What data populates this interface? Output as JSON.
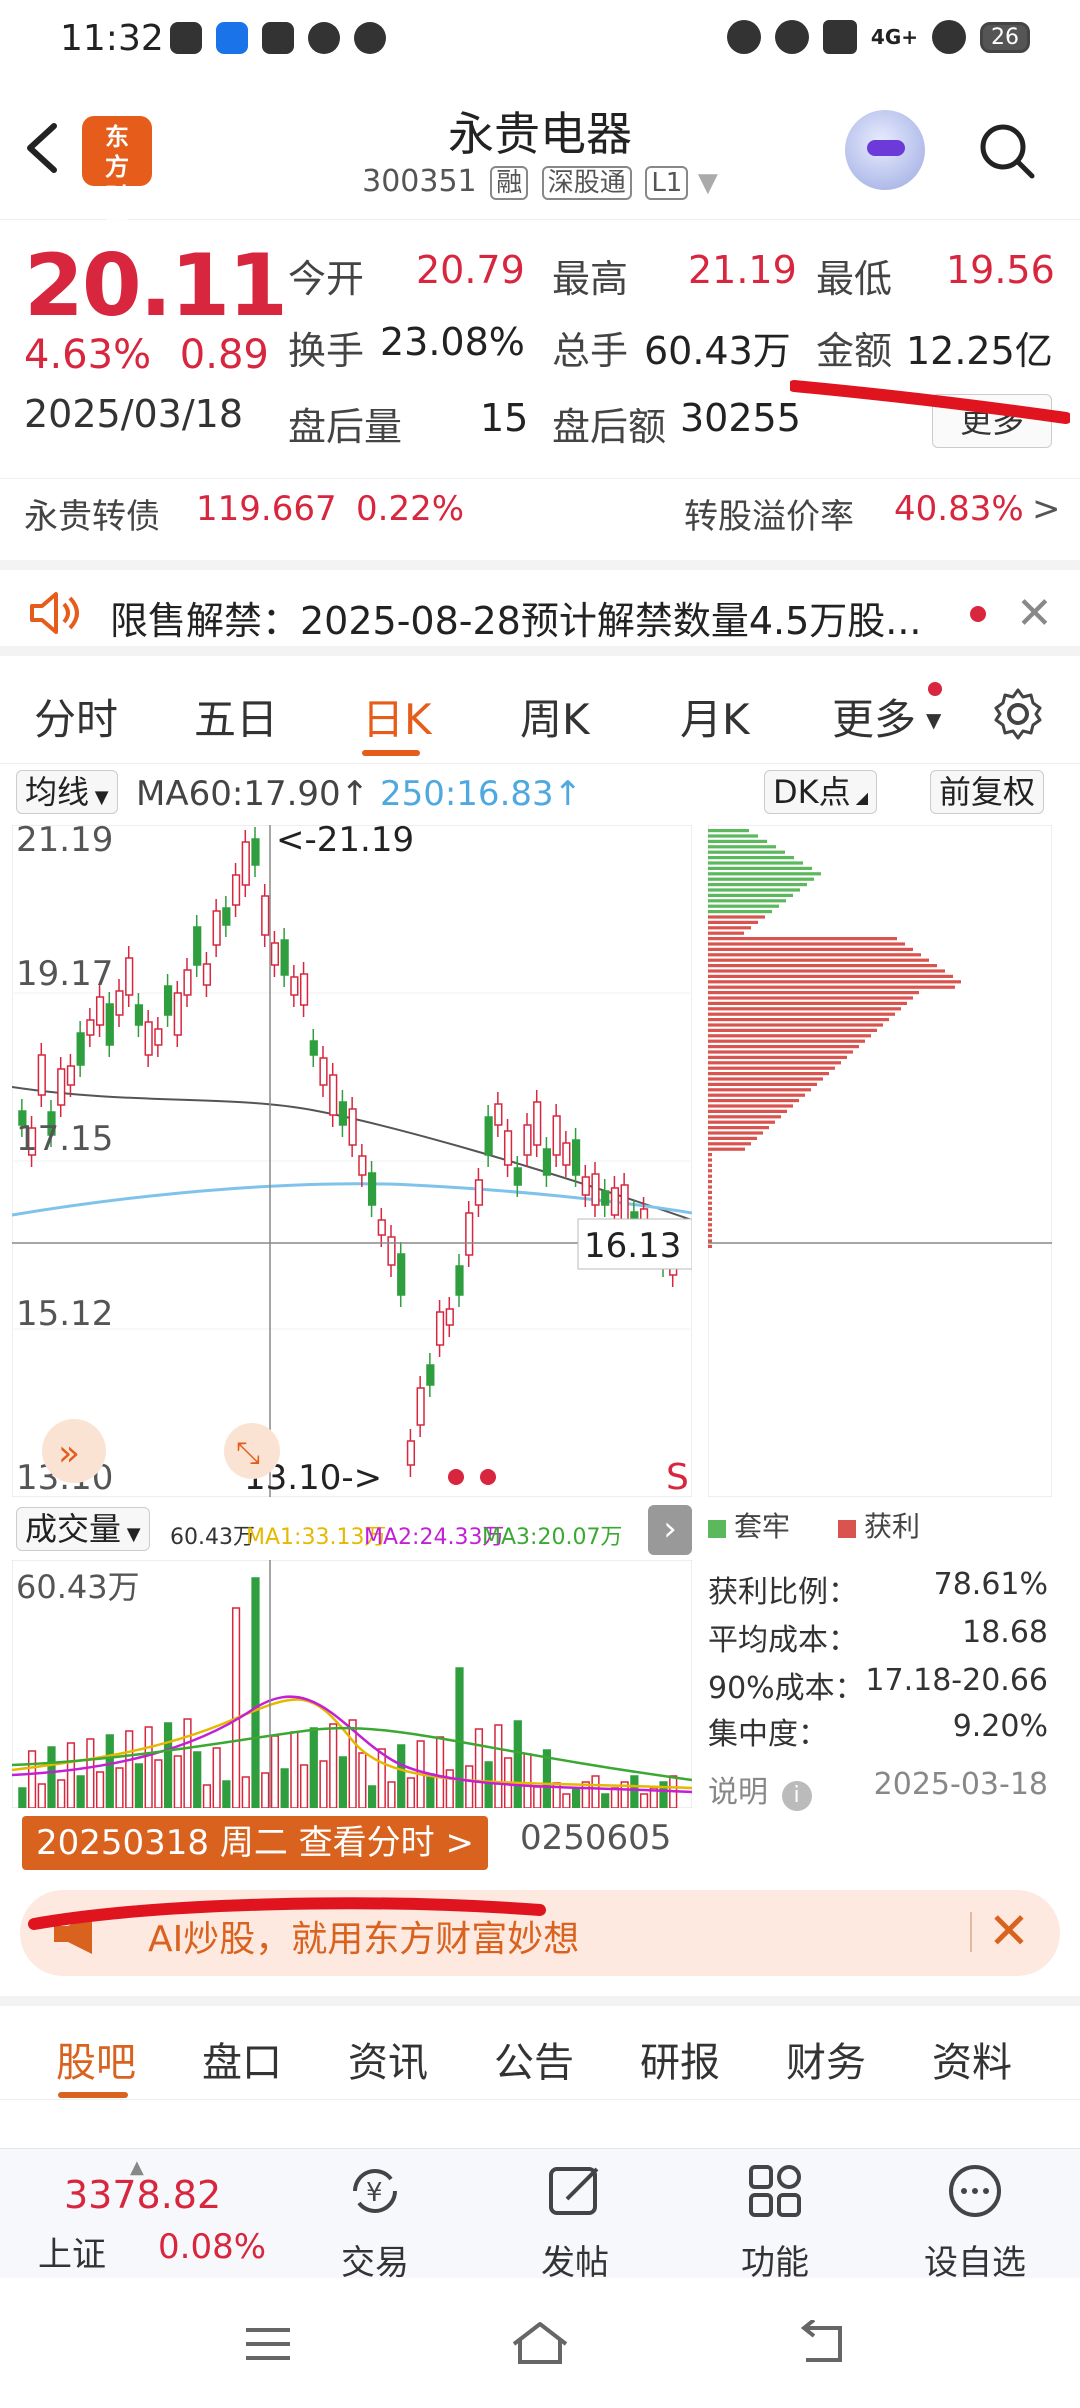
{
  "status_bar": {
    "time": "11:32",
    "network": "4G+",
    "battery": "26"
  },
  "header": {
    "title": "永贵电器",
    "code": "300351",
    "tags": [
      "融",
      "深股通",
      "L1"
    ],
    "logo_text": "东方财富"
  },
  "quote": {
    "price": "20.11",
    "change_pct": "4.63%",
    "change": "0.89",
    "date": "2025/03/18",
    "open_label": "今开",
    "open": "20.79",
    "high_label": "最高",
    "high": "21.19",
    "low_label": "最低",
    "low": "19.56",
    "turnover_label": "换手",
    "turnover": "23.08%",
    "volume_label": "总手",
    "volume": "60.43万",
    "amount_label": "金额",
    "amount": "12.25亿",
    "after_vol_label": "盘后量",
    "after_vol": "15",
    "after_amt_label": "盘后额",
    "after_amt": "30255",
    "more_label": "更多"
  },
  "bond": {
    "name": "永贵转债",
    "price": "119.667",
    "pct": "0.22%",
    "premium_label": "转股溢价率",
    "premium": "40.83%"
  },
  "notice": {
    "text": "限售解禁：2025-08-28预计解禁数量4.5万股..."
  },
  "chart_tabs": [
    "分时",
    "五日",
    "日K",
    "周K",
    "月K",
    "更多"
  ],
  "ma_bar": {
    "ma_button": "均线",
    "ma60": "MA60:17.90↑",
    "ma250": "250:16.83↑",
    "dk_button": "DK点",
    "adjust_button": "前复权"
  },
  "chart_data": {
    "type": "candlestick",
    "y_ticks": [
      "21.19",
      "19.17",
      "17.15",
      "15.12",
      "13.10"
    ],
    "ylim": [
      13.1,
      21.19
    ],
    "annotations": {
      "high": "<-21.19",
      "low": "13.10->",
      "cursor": "16.13",
      "signal": "S"
    },
    "volume_label": "成交量",
    "volume_readout": "60.43万",
    "volume_ma": [
      {
        "name": "MA1",
        "value": "33.13万",
        "color": "#e6b800"
      },
      {
        "name": "MA2",
        "value": "24.33万",
        "color": "#c21fd6"
      },
      {
        "name": "MA3",
        "value": "20.07万",
        "color": "#3aa832"
      }
    ],
    "volume_max_label": "60.43万",
    "start_date_box": "20250318 周二 查看分时 >",
    "end_date": "0250605"
  },
  "distribution": {
    "legend_trapped": "套牢",
    "legend_profit": "获利",
    "rows": [
      {
        "label": "获利比例：",
        "value": "78.61%"
      },
      {
        "label": "平均成本：",
        "value": "18.68"
      },
      {
        "label": "90%成本：",
        "value": "17.18-20.66"
      },
      {
        "label": "集中度：",
        "value": "9.20%"
      }
    ],
    "note_label": "说明",
    "date": "2025-03-18"
  },
  "ai_banner": {
    "text": "AI炒股，就用东方财富妙想"
  },
  "bottom_tabs": [
    "股吧",
    "盘口",
    "资讯",
    "公告",
    "研报",
    "财务",
    "资料"
  ],
  "bottom_nav": {
    "index_value": "3378.82",
    "index_name": "上证",
    "index_pct": "0.08%",
    "trade": "交易",
    "post": "发帖",
    "functions": "功能",
    "add_watch": "设自选"
  },
  "colors": {
    "up": "#d7263d",
    "down": "#2e9e3f",
    "accent": "#e65d1b"
  }
}
